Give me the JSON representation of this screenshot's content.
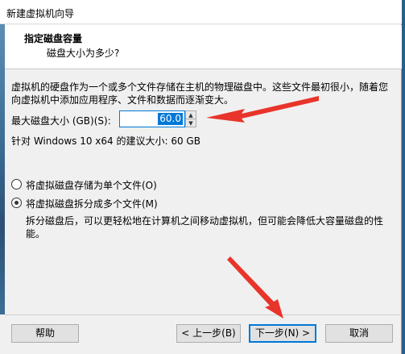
{
  "window": {
    "title": "新建虚拟机向导"
  },
  "header": {
    "title": "指定磁盘容量",
    "subtitle": "磁盘大小为多少?"
  },
  "description": "虚拟机的硬盘作为一个或多个文件存储在主机的物理磁盘中。这些文件最初很小，随着您向虚拟机中添加应用程序、文件和数据而逐渐变大。",
  "disk_size": {
    "label": "最大磁盘大小 (GB)(S):",
    "value": "60.0"
  },
  "recommendation": "针对 Windows 10 x64 的建议大小: 60 GB",
  "options": [
    {
      "label": "将虚拟磁盘存储为单个文件(O)",
      "checked": false
    },
    {
      "label": "将虚拟磁盘拆分成多个文件(M)",
      "checked": true
    }
  ],
  "split_note": "拆分磁盘后，可以更轻松地在计算机之间移动虚拟机，但可能会降低大容量磁盘的性能。",
  "buttons": {
    "help": "帮助",
    "back": "< 上一步(B)",
    "next": "下一步(N) >",
    "cancel": "取消"
  },
  "annotation_color": "#e8342b",
  "icons": {
    "spin_up": "spin-up-icon",
    "spin_down": "spin-down-icon"
  }
}
